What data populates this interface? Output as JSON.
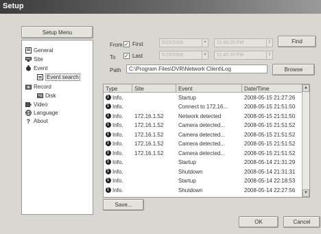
{
  "window": {
    "title": "Setup"
  },
  "setup_menu_label": "Setup Menu",
  "tree": [
    {
      "label": "General",
      "icon": "general-icon"
    },
    {
      "label": "Site",
      "icon": "site-icon"
    },
    {
      "label": "Event",
      "icon": "event-icon"
    },
    {
      "label": "Event search",
      "icon": "event-search-icon"
    },
    {
      "label": "Record",
      "icon": "record-icon"
    },
    {
      "label": "Disk",
      "icon": "disk-icon"
    },
    {
      "label": "Video",
      "icon": "video-icon"
    },
    {
      "label": "Language",
      "icon": "language-icon"
    },
    {
      "label": "About",
      "icon": "about-icon"
    }
  ],
  "filter": {
    "from_label": "From",
    "to_label": "To",
    "first_label": "First",
    "last_label": "Last",
    "from_date": "5/15/2008",
    "from_time": "11:45:20 PM",
    "to_date": "5/15/2008",
    "to_time": "11:45:20 PM",
    "find_label": "Find",
    "path_label": "Path",
    "path_value": "C:\\Program Files\\DVR\\Network Client\\Log",
    "browse_label": "Browse"
  },
  "table": {
    "headers": [
      "Type",
      "Site",
      "Event",
      "Date/Time"
    ],
    "rows": [
      [
        "Info.",
        "",
        "Startup",
        "2008-05-15 21:27:26"
      ],
      [
        "Info.",
        "",
        "Connect to 172.16...",
        "2008-05-15 21:51:50"
      ],
      [
        "Info.",
        "172.16.1.52",
        "Network detected",
        "2008-05-15 21:51:50"
      ],
      [
        "Info.",
        "172.16.1.52",
        "Camera detected...",
        "2008-05-15 21:51:52"
      ],
      [
        "Info.",
        "172.16.1.52",
        "Camera detected...",
        "2008-05-15 21:51:52"
      ],
      [
        "Info.",
        "172.16.1.52",
        "Camera detected...",
        "2008-05-15 21:51:52"
      ],
      [
        "Info.",
        "172.16.1.52",
        "Camera detected...",
        "2008-05-15 21:51:52"
      ],
      [
        "Info.",
        "",
        "Startup",
        "2008-05-14 21:31:29"
      ],
      [
        "Info.",
        "",
        "Shutdown",
        "2008-05-14 21:31:31"
      ],
      [
        "Info.",
        "",
        "Startup",
        "2008-05-14 22:18:53"
      ],
      [
        "Info.",
        "",
        "Shutdown",
        "2008-05-14 22:27:56"
      ]
    ]
  },
  "save_label": "Save...",
  "ok_label": "OK",
  "cancel_label": "Cancel",
  "colors": {
    "accent_title": "#3d3d3d",
    "panel_bg": "#d8d7d2"
  }
}
